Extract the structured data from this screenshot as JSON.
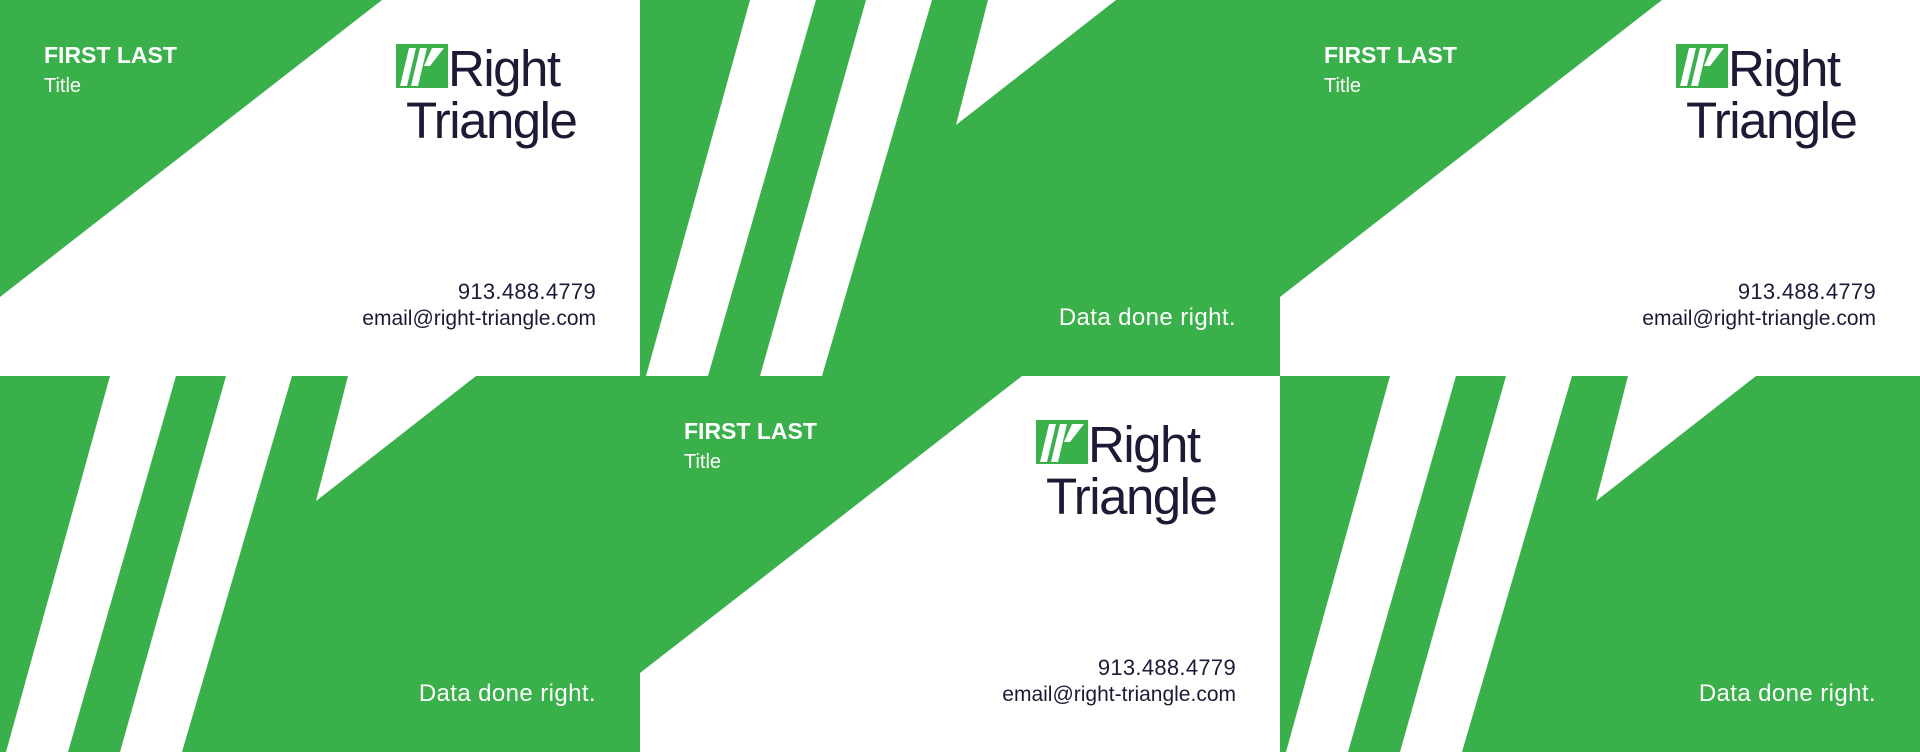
{
  "brand": {
    "name_line1": "Right",
    "name_line2": "Triangle",
    "green": "#39b04a",
    "navy": "#1e1a35"
  },
  "card_front": {
    "name": "FIRST LAST",
    "title": "Title",
    "phone": "913.488.4779",
    "email": "email@right-triangle.com"
  },
  "card_back": {
    "tagline": "Data done right."
  },
  "layout_note_cards": [
    "front",
    "back",
    "front",
    "back",
    "front",
    "back"
  ]
}
